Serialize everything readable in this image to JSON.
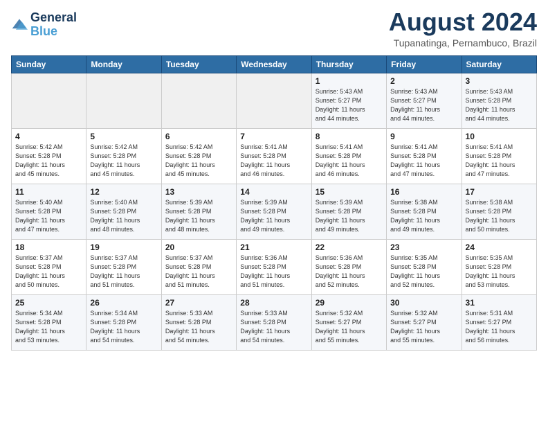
{
  "header": {
    "logo_line1": "General",
    "logo_line2": "Blue",
    "title": "August 2024",
    "subtitle": "Tupanatinga, Pernambuco, Brazil"
  },
  "days_of_week": [
    "Sunday",
    "Monday",
    "Tuesday",
    "Wednesday",
    "Thursday",
    "Friday",
    "Saturday"
  ],
  "weeks": [
    [
      {
        "day": "",
        "empty": true
      },
      {
        "day": "",
        "empty": true
      },
      {
        "day": "",
        "empty": true
      },
      {
        "day": "",
        "empty": true
      },
      {
        "day": "1",
        "sunrise": "5:43 AM",
        "sunset": "5:27 PM",
        "daylight": "11 hours and 44 minutes."
      },
      {
        "day": "2",
        "sunrise": "5:43 AM",
        "sunset": "5:27 PM",
        "daylight": "11 hours and 44 minutes."
      },
      {
        "day": "3",
        "sunrise": "5:43 AM",
        "sunset": "5:28 PM",
        "daylight": "11 hours and 44 minutes."
      }
    ],
    [
      {
        "day": "4",
        "sunrise": "5:42 AM",
        "sunset": "5:28 PM",
        "daylight": "11 hours and 45 minutes."
      },
      {
        "day": "5",
        "sunrise": "5:42 AM",
        "sunset": "5:28 PM",
        "daylight": "11 hours and 45 minutes."
      },
      {
        "day": "6",
        "sunrise": "5:42 AM",
        "sunset": "5:28 PM",
        "daylight": "11 hours and 45 minutes."
      },
      {
        "day": "7",
        "sunrise": "5:41 AM",
        "sunset": "5:28 PM",
        "daylight": "11 hours and 46 minutes."
      },
      {
        "day": "8",
        "sunrise": "5:41 AM",
        "sunset": "5:28 PM",
        "daylight": "11 hours and 46 minutes."
      },
      {
        "day": "9",
        "sunrise": "5:41 AM",
        "sunset": "5:28 PM",
        "daylight": "11 hours and 47 minutes."
      },
      {
        "day": "10",
        "sunrise": "5:41 AM",
        "sunset": "5:28 PM",
        "daylight": "11 hours and 47 minutes."
      }
    ],
    [
      {
        "day": "11",
        "sunrise": "5:40 AM",
        "sunset": "5:28 PM",
        "daylight": "11 hours and 47 minutes."
      },
      {
        "day": "12",
        "sunrise": "5:40 AM",
        "sunset": "5:28 PM",
        "daylight": "11 hours and 48 minutes."
      },
      {
        "day": "13",
        "sunrise": "5:39 AM",
        "sunset": "5:28 PM",
        "daylight": "11 hours and 48 minutes."
      },
      {
        "day": "14",
        "sunrise": "5:39 AM",
        "sunset": "5:28 PM",
        "daylight": "11 hours and 49 minutes."
      },
      {
        "day": "15",
        "sunrise": "5:39 AM",
        "sunset": "5:28 PM",
        "daylight": "11 hours and 49 minutes."
      },
      {
        "day": "16",
        "sunrise": "5:38 AM",
        "sunset": "5:28 PM",
        "daylight": "11 hours and 49 minutes."
      },
      {
        "day": "17",
        "sunrise": "5:38 AM",
        "sunset": "5:28 PM",
        "daylight": "11 hours and 50 minutes."
      }
    ],
    [
      {
        "day": "18",
        "sunrise": "5:37 AM",
        "sunset": "5:28 PM",
        "daylight": "11 hours and 50 minutes."
      },
      {
        "day": "19",
        "sunrise": "5:37 AM",
        "sunset": "5:28 PM",
        "daylight": "11 hours and 51 minutes."
      },
      {
        "day": "20",
        "sunrise": "5:37 AM",
        "sunset": "5:28 PM",
        "daylight": "11 hours and 51 minutes."
      },
      {
        "day": "21",
        "sunrise": "5:36 AM",
        "sunset": "5:28 PM",
        "daylight": "11 hours and 51 minutes."
      },
      {
        "day": "22",
        "sunrise": "5:36 AM",
        "sunset": "5:28 PM",
        "daylight": "11 hours and 52 minutes."
      },
      {
        "day": "23",
        "sunrise": "5:35 AM",
        "sunset": "5:28 PM",
        "daylight": "11 hours and 52 minutes."
      },
      {
        "day": "24",
        "sunrise": "5:35 AM",
        "sunset": "5:28 PM",
        "daylight": "11 hours and 53 minutes."
      }
    ],
    [
      {
        "day": "25",
        "sunrise": "5:34 AM",
        "sunset": "5:28 PM",
        "daylight": "11 hours and 53 minutes."
      },
      {
        "day": "26",
        "sunrise": "5:34 AM",
        "sunset": "5:28 PM",
        "daylight": "11 hours and 54 minutes."
      },
      {
        "day": "27",
        "sunrise": "5:33 AM",
        "sunset": "5:28 PM",
        "daylight": "11 hours and 54 minutes."
      },
      {
        "day": "28",
        "sunrise": "5:33 AM",
        "sunset": "5:28 PM",
        "daylight": "11 hours and 54 minutes."
      },
      {
        "day": "29",
        "sunrise": "5:32 AM",
        "sunset": "5:27 PM",
        "daylight": "11 hours and 55 minutes."
      },
      {
        "day": "30",
        "sunrise": "5:32 AM",
        "sunset": "5:27 PM",
        "daylight": "11 hours and 55 minutes."
      },
      {
        "day": "31",
        "sunrise": "5:31 AM",
        "sunset": "5:27 PM",
        "daylight": "11 hours and 56 minutes."
      }
    ]
  ],
  "labels": {
    "sunrise": "Sunrise:",
    "sunset": "Sunset:",
    "daylight": "Daylight:"
  }
}
